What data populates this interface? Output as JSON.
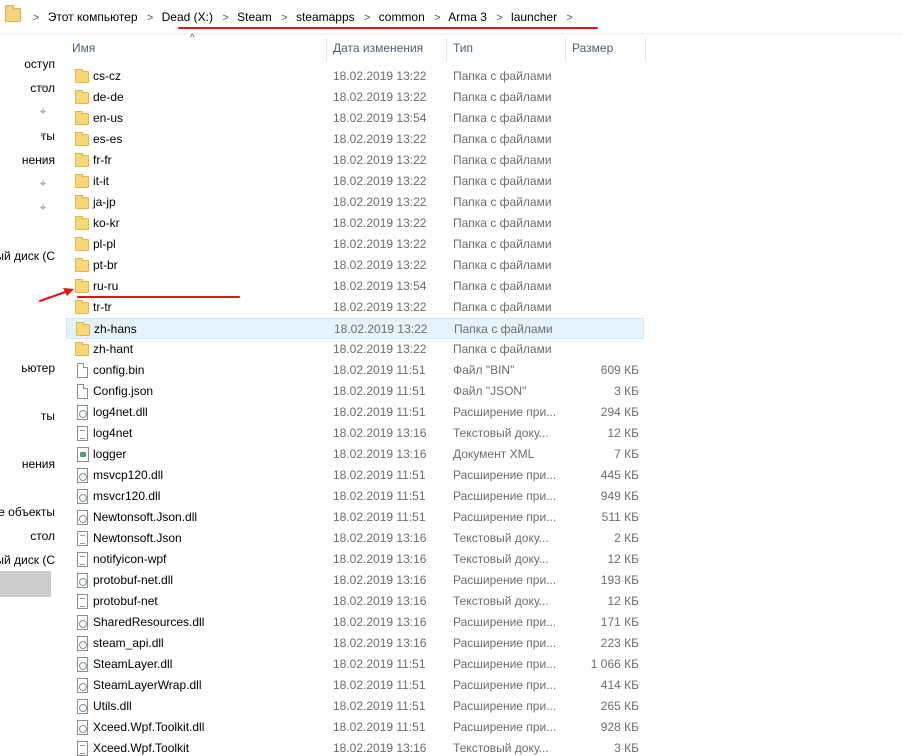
{
  "breadcrumb": {
    "items": [
      "Этот компьютер",
      "Dead (X:)",
      "Steam",
      "steamapps",
      "common",
      "Arma 3",
      "launcher"
    ],
    "separator": ">"
  },
  "nav": {
    "items": [
      {
        "label": "оступ",
        "pinned": false
      },
      {
        "label": "стол",
        "pinned": true
      },
      {
        "label": "",
        "pinned": true
      },
      {
        "label": "ты",
        "pinned": true
      },
      {
        "label": "нения",
        "pinned": true
      },
      {
        "label": "",
        "pinned": true
      },
      {
        "label": "",
        "pinned": true
      },
      {
        "label": "ый диск (С",
        "pinned": false
      },
      {
        "label": "ьютер",
        "pinned": false
      },
      {
        "label": "ты",
        "pinned": false
      },
      {
        "label": "нения",
        "pinned": false
      },
      {
        "label": "ие объекты",
        "pinned": false
      },
      {
        "label": "стол",
        "pinned": false
      },
      {
        "label": "ый диск (С",
        "pinned": false
      }
    ]
  },
  "columns": {
    "name": "Имя",
    "date": "Дата изменения",
    "type": "Тип",
    "size": "Размер"
  },
  "files": [
    {
      "name": "cs-cz",
      "date": "18.02.2019 13:22",
      "type": "Папка с файлами",
      "size": "",
      "icon": "folder-icon"
    },
    {
      "name": "de-de",
      "date": "18.02.2019 13:22",
      "type": "Папка с файлами",
      "size": "",
      "icon": "folder-icon"
    },
    {
      "name": "en-us",
      "date": "18.02.2019 13:54",
      "type": "Папка с файлами",
      "size": "",
      "icon": "folder-icon"
    },
    {
      "name": "es-es",
      "date": "18.02.2019 13:22",
      "type": "Папка с файлами",
      "size": "",
      "icon": "folder-icon"
    },
    {
      "name": "fr-fr",
      "date": "18.02.2019 13:22",
      "type": "Папка с файлами",
      "size": "",
      "icon": "folder-icon"
    },
    {
      "name": "it-it",
      "date": "18.02.2019 13:22",
      "type": "Папка с файлами",
      "size": "",
      "icon": "folder-icon"
    },
    {
      "name": "ja-jp",
      "date": "18.02.2019 13:22",
      "type": "Папка с файлами",
      "size": "",
      "icon": "folder-icon"
    },
    {
      "name": "ko-kr",
      "date": "18.02.2019 13:22",
      "type": "Папка с файлами",
      "size": "",
      "icon": "folder-icon"
    },
    {
      "name": "pl-pl",
      "date": "18.02.2019 13:22",
      "type": "Папка с файлами",
      "size": "",
      "icon": "folder-icon"
    },
    {
      "name": "pt-br",
      "date": "18.02.2019 13:22",
      "type": "Папка с файлами",
      "size": "",
      "icon": "folder-icon"
    },
    {
      "name": "ru-ru",
      "date": "18.02.2019 13:54",
      "type": "Папка с файлами",
      "size": "",
      "icon": "folder-icon"
    },
    {
      "name": "tr-tr",
      "date": "18.02.2019 13:22",
      "type": "Папка с файлами",
      "size": "",
      "icon": "folder-icon"
    },
    {
      "name": "zh-hans",
      "date": "18.02.2019 13:22",
      "type": "Папка с файлами",
      "size": "",
      "icon": "folder-icon",
      "hover": true
    },
    {
      "name": "zh-hant",
      "date": "18.02.2019 13:22",
      "type": "Папка с файлами",
      "size": "",
      "icon": "folder-icon"
    },
    {
      "name": "config.bin",
      "date": "18.02.2019 11:51",
      "type": "Файл \"BIN\"",
      "size": "609 КБ",
      "icon": "file-icon"
    },
    {
      "name": "Config.json",
      "date": "18.02.2019 11:51",
      "type": "Файл \"JSON\"",
      "size": "3 КБ",
      "icon": "file-icon"
    },
    {
      "name": "log4net.dll",
      "date": "18.02.2019 11:51",
      "type": "Расширение при...",
      "size": "294 КБ",
      "icon": "dll-icon"
    },
    {
      "name": "log4net",
      "date": "18.02.2019 13:16",
      "type": "Текстовый доку...",
      "size": "12 КБ",
      "icon": "text-file-icon"
    },
    {
      "name": "logger",
      "date": "18.02.2019 13:16",
      "type": "Документ XML",
      "size": "7 КБ",
      "icon": "xml-file-icon"
    },
    {
      "name": "msvcp120.dll",
      "date": "18.02.2019 11:51",
      "type": "Расширение при...",
      "size": "445 КБ",
      "icon": "dll-icon"
    },
    {
      "name": "msvcr120.dll",
      "date": "18.02.2019 11:51",
      "type": "Расширение при...",
      "size": "949 КБ",
      "icon": "dll-icon"
    },
    {
      "name": "Newtonsoft.Json.dll",
      "date": "18.02.2019 11:51",
      "type": "Расширение при...",
      "size": "511 КБ",
      "icon": "dll-icon"
    },
    {
      "name": "Newtonsoft.Json",
      "date": "18.02.2019 13:16",
      "type": "Текстовый доку...",
      "size": "2 КБ",
      "icon": "text-file-icon"
    },
    {
      "name": "notifyicon-wpf",
      "date": "18.02.2019 13:16",
      "type": "Текстовый доку...",
      "size": "12 КБ",
      "icon": "text-file-icon"
    },
    {
      "name": "protobuf-net.dll",
      "date": "18.02.2019 13:16",
      "type": "Расширение при...",
      "size": "193 КБ",
      "icon": "dll-icon"
    },
    {
      "name": "protobuf-net",
      "date": "18.02.2019 13:16",
      "type": "Текстовый доку...",
      "size": "12 КБ",
      "icon": "text-file-icon"
    },
    {
      "name": "SharedResources.dll",
      "date": "18.02.2019 13:16",
      "type": "Расширение при...",
      "size": "171 КБ",
      "icon": "dll-icon"
    },
    {
      "name": "steam_api.dll",
      "date": "18.02.2019 13:16",
      "type": "Расширение при...",
      "size": "223 КБ",
      "icon": "dll-icon"
    },
    {
      "name": "SteamLayer.dll",
      "date": "18.02.2019 11:51",
      "type": "Расширение при...",
      "size": "1 066 КБ",
      "icon": "dll-icon"
    },
    {
      "name": "SteamLayerWrap.dll",
      "date": "18.02.2019 11:51",
      "type": "Расширение при...",
      "size": "414 КБ",
      "icon": "dll-icon"
    },
    {
      "name": "Utils.dll",
      "date": "18.02.2019 11:51",
      "type": "Расширение при...",
      "size": "265 КБ",
      "icon": "dll-icon"
    },
    {
      "name": "Xceed.Wpf.Toolkit.dll",
      "date": "18.02.2019 11:51",
      "type": "Расширение при...",
      "size": "928 КБ",
      "icon": "dll-icon"
    },
    {
      "name": "Xceed.Wpf.Toolkit",
      "date": "18.02.2019 13:16",
      "type": "Текстовый доку...",
      "size": "3 КБ",
      "icon": "text-file-icon"
    }
  ],
  "colors": {
    "annotation_red": "#e0131b",
    "hover_row": "#e5f3ff",
    "header_text": "#4c607a",
    "folder_yellow": "#f8d775"
  }
}
